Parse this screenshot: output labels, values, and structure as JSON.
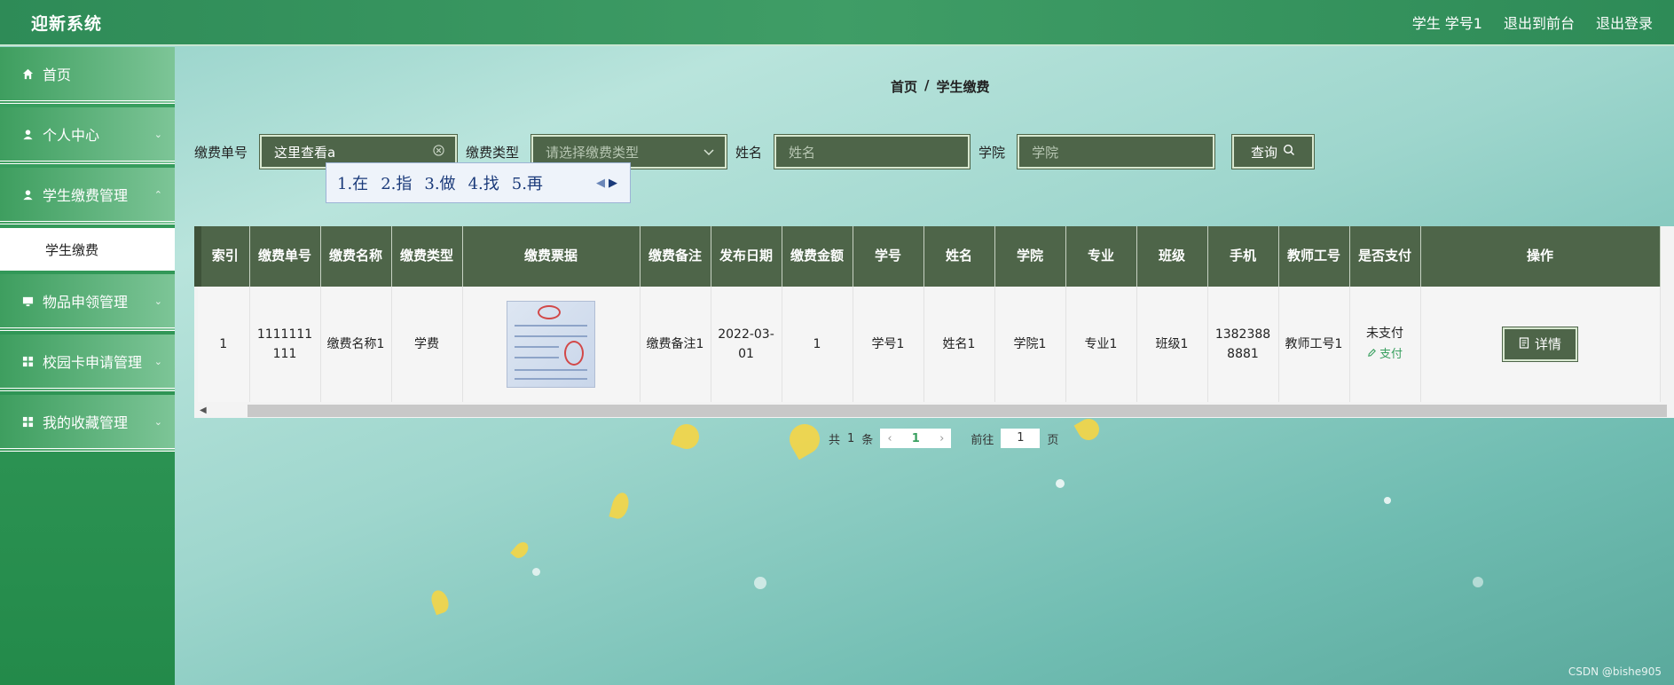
{
  "header": {
    "app_title": "迎新系统",
    "user_label": "学生 学号1",
    "front_link": "退出到前台",
    "logout_link": "退出登录"
  },
  "sidebar": {
    "items": [
      {
        "label": "首页",
        "icon": "home-icon"
      },
      {
        "label": "个人中心",
        "icon": "user-icon"
      },
      {
        "label": "学生缴费管理",
        "icon": "user-icon"
      },
      {
        "label": "物品申领管理",
        "icon": "monitor-icon"
      },
      {
        "label": "校园卡申请管理",
        "icon": "grid-icon"
      },
      {
        "label": "我的收藏管理",
        "icon": "grid-icon"
      }
    ],
    "active_sub": "学生缴费"
  },
  "breadcrumb": {
    "home": "首页",
    "sep": "/",
    "current": "学生缴费"
  },
  "filters": {
    "bill_no_label": "缴费单号",
    "bill_no_value": "这里查看a",
    "type_label": "缴费类型",
    "type_placeholder": "请选择缴费类型",
    "name_label": "姓名",
    "name_placeholder": "姓名",
    "college_label": "学院",
    "college_placeholder": "学院",
    "query_button": "查询"
  },
  "ime": {
    "candidates": [
      "1.在",
      "2.指",
      "3.做",
      "4.找",
      "5.再"
    ]
  },
  "table": {
    "columns": [
      "索引",
      "缴费单号",
      "缴费名称",
      "缴费类型",
      "缴费票据",
      "缴费备注",
      "发布日期",
      "缴费金额",
      "学号",
      "姓名",
      "学院",
      "专业",
      "班级",
      "手机",
      "教师工号",
      "是否支付",
      "操作"
    ],
    "rows": [
      {
        "index": "1",
        "bill_no": "1111111111",
        "fee_name": "缴费名称1",
        "fee_type": "学费",
        "remark": "缴费备注1",
        "date": "2022-03-01",
        "amount": "1",
        "student_no": "学号1",
        "name": "姓名1",
        "college": "学院1",
        "major": "专业1",
        "class": "班级1",
        "phone": "13823888881",
        "teacher_no": "教师工号1",
        "paid_status": "未支付",
        "pay_action": "支付",
        "detail_button": "详情"
      }
    ]
  },
  "pagination": {
    "total_prefix": "共",
    "total": "1",
    "total_suffix": "条",
    "current": "1",
    "goto_prefix": "前往",
    "goto_value": "1",
    "goto_suffix": "页"
  },
  "watermark": "CSDN @bishe905",
  "colors": {
    "primary": "#2e8b57",
    "table_header": "#4e6549",
    "link": "#3aa060"
  }
}
